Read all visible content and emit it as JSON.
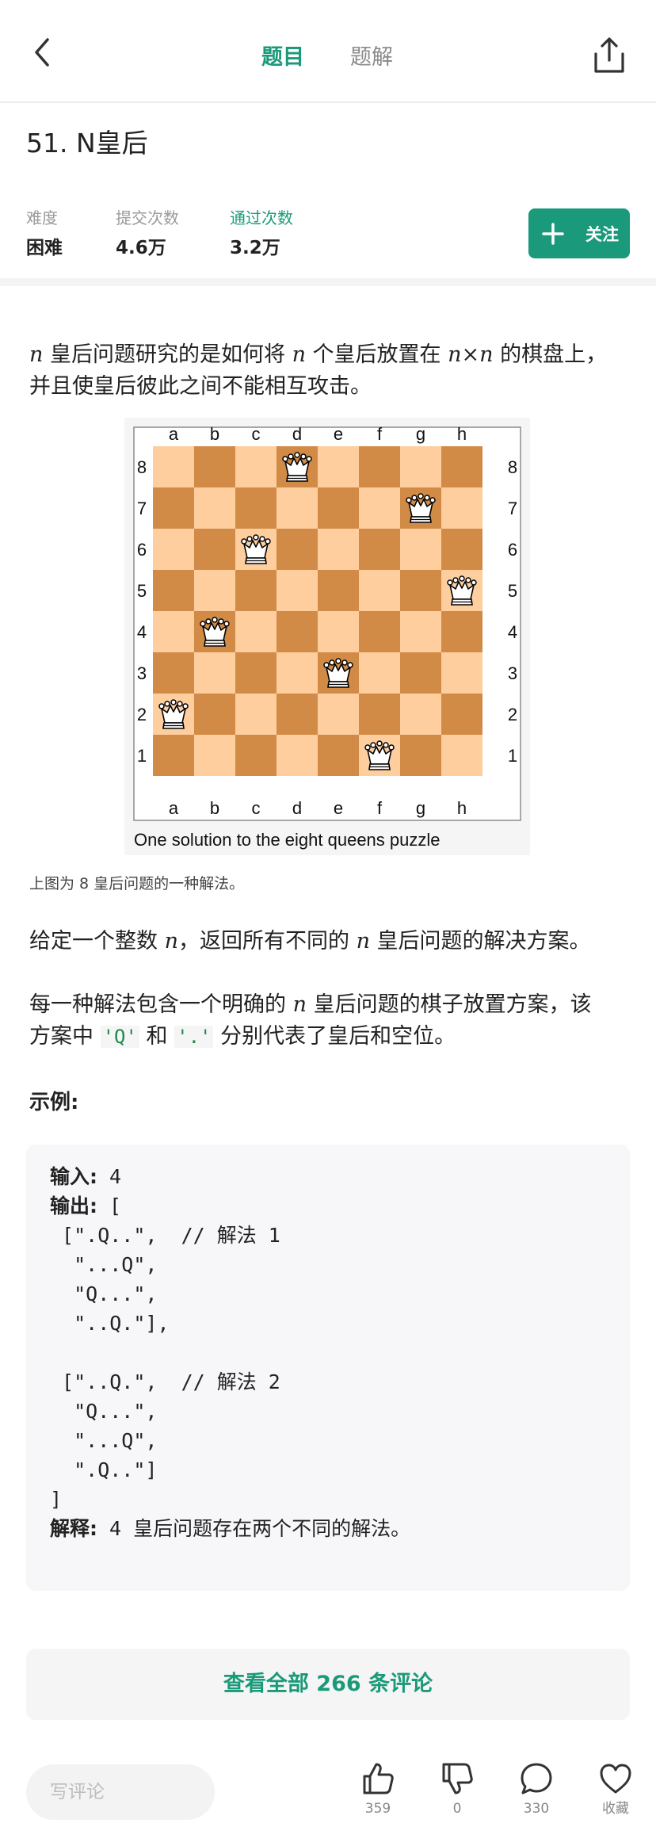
{
  "header": {
    "tabs": [
      {
        "label": "题目",
        "active": true
      },
      {
        "label": "题解",
        "active": false
      }
    ],
    "icons": [
      "back-arrow-icon",
      "share-icon"
    ],
    "accent": "#1a9a7a"
  },
  "problem": {
    "title": "51. N皇后",
    "stats": [
      {
        "label": "难度",
        "value": "困难"
      },
      {
        "label": "提交次数",
        "value": "4.6万"
      },
      {
        "label": "通过次数",
        "value": "3.2万"
      }
    ],
    "follow_label": "关注"
  },
  "description": {
    "p1_pre": " 皇后问题研究的是如何将 ",
    "p1_mid": " 个皇后放置在 ",
    "p1_post": " 的棋盘上，",
    "p1_line2": "并且使皇后彼此之间不能相互攻击。",
    "n": "n",
    "nxn": "n×n",
    "caption": "上图为 8 皇后问题的一种解法。",
    "p2_pre": "给定一个整数 ",
    "p2_mid": "，返回所有不同的 ",
    "p2_post": " 皇后问题的解决方案。",
    "p3_pre": "每一种解法包含一个明确的 ",
    "p3_post": " 皇后问题的棋子放置方案，该",
    "p3_line2_pre": "方案中 ",
    "q_code": "'Q'",
    "and": " 和 ",
    "dot_code": "'.'",
    "p3_line2_post": " 分别代表了皇后和空位。",
    "example_label": "示例:"
  },
  "board": {
    "files": [
      "a",
      "b",
      "c",
      "d",
      "e",
      "f",
      "g",
      "h"
    ],
    "ranks": [
      "8",
      "7",
      "6",
      "5",
      "4",
      "3",
      "2",
      "1"
    ],
    "queens": [
      "d8",
      "g7",
      "c6",
      "h5",
      "b4",
      "e3",
      "a2",
      "f1"
    ],
    "caption": "One solution to the eight queens puzzle",
    "light": "#ffce9e",
    "dark": "#d18b47"
  },
  "example": {
    "input_label": "输入:",
    "input_value": " 4",
    "output_label": "输出:",
    "output_body": " [\n [\".Q..\",  // 解法 1\n  \"...Q\",\n  \"Q...\",\n  \"..Q.\"],\n\n [\"..Q.\",  // 解法 2\n  \"Q...\",\n  \"...Q\",\n  \".Q..\"]\n]",
    "explain_label": "解释:",
    "explain_value": " 4 皇后问题存在两个不同的解法。"
  },
  "comments_button": "查看全部 266 条评论",
  "bottom_bar": {
    "input_placeholder": "写评论",
    "actions": [
      {
        "icon": "thumbs-up-icon",
        "count": "359"
      },
      {
        "icon": "thumbs-down-icon",
        "count": "0"
      },
      {
        "icon": "comment-icon",
        "count": "330"
      },
      {
        "icon": "heart-icon",
        "count": "收藏"
      }
    ]
  }
}
